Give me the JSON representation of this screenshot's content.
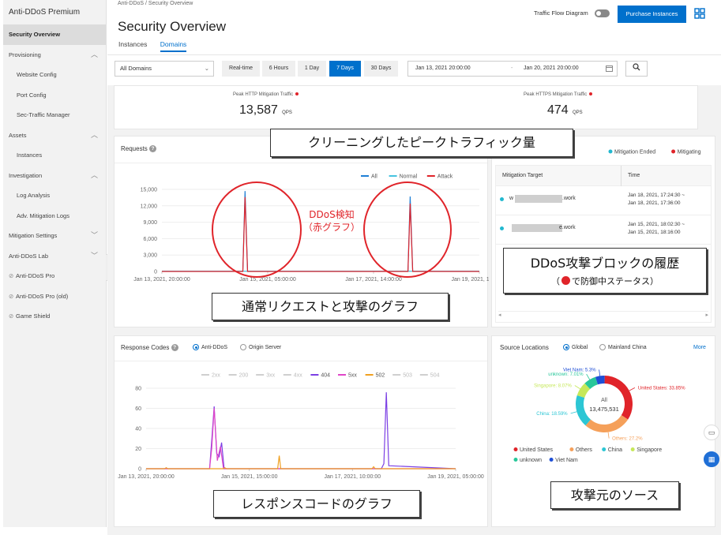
{
  "sidebar": {
    "title": "Anti-DDoS Premium",
    "items": [
      {
        "label": "Security Overview",
        "active": true,
        "type": "top"
      },
      {
        "label": "Provisioning",
        "type": "group",
        "expanded": true
      },
      {
        "label": "Website Config",
        "type": "sub"
      },
      {
        "label": "Port Config",
        "type": "sub"
      },
      {
        "label": "Sec-Traffic Manager",
        "type": "sub"
      },
      {
        "label": "Assets",
        "type": "group",
        "expanded": true
      },
      {
        "label": "Instances",
        "type": "sub"
      },
      {
        "label": "Investigation",
        "type": "group",
        "expanded": true
      },
      {
        "label": "Log Analysis",
        "type": "sub"
      },
      {
        "label": "Adv. Mitigation Logs",
        "type": "sub"
      },
      {
        "label": "Mitigation Settings",
        "type": "group",
        "expanded": false
      },
      {
        "label": "Anti-DDoS Lab",
        "type": "group",
        "expanded": false
      },
      {
        "label": "Anti-DDoS Pro",
        "type": "link"
      },
      {
        "label": "Anti-DDoS Pro (old)",
        "type": "link"
      },
      {
        "label": "Game Shield",
        "type": "link"
      }
    ]
  },
  "header": {
    "breadcrumb": "Anti-DDoS  /  Security Overview",
    "title": "Security Overview",
    "tabs": [
      "Instances",
      "Domains"
    ],
    "active_tab": "Domains",
    "traffic_flow_label": "Traffic Flow Diagram",
    "purchase_label": "Purchase Instances"
  },
  "filter": {
    "domain_select": "All Domains",
    "time_buttons": [
      "Real-time",
      "6 Hours",
      "1 Day",
      "7 Days",
      "30 Days"
    ],
    "active_time": "7 Days",
    "start_date": "Jan 13, 2021 20:00:00",
    "separator": "-",
    "end_date": "Jan 20, 2021 20:00:00"
  },
  "peaks": {
    "http_label": "Peak HTTP Mitigation Traffic",
    "http_value": "13,587",
    "http_unit": "QPS",
    "https_label": "Peak HTTPS Mitigation Traffic",
    "https_value": "474",
    "https_unit": "QPS"
  },
  "requests_card": {
    "title": "Requests",
    "legend": [
      "All",
      "Normal",
      "Attack"
    ],
    "legend_colors": [
      "#1f7fd6",
      "#47c3e0",
      "#e0242a"
    ]
  },
  "mitigation_card": {
    "legend": [
      "Mitigation Ended",
      "Mitigating"
    ],
    "legend_colors": [
      "#22b8cf",
      "#e0242a"
    ],
    "col_target": "Mitigation Target",
    "col_time": "Time",
    "rows": [
      {
        "target_prefix": "w",
        "target_suffix": ".work",
        "time1": "Jan 18, 2021, 17:24:30 ~",
        "time2": "Jan 18, 2021, 17:36:00"
      },
      {
        "target_prefix": "",
        "target_suffix": "e.work",
        "time1": "Jan 15, 2021, 18:02:30 ~",
        "time2": "Jan 15, 2021, 18:16:00"
      }
    ]
  },
  "response_card": {
    "title": "Response Codes",
    "radio1": "Anti-DDoS",
    "radio2": "Origin Server",
    "legend": [
      {
        "name": "2xx",
        "color": "#cfcfcf",
        "active": false
      },
      {
        "name": "200",
        "color": "#cfcfcf",
        "active": false
      },
      {
        "name": "3xx",
        "color": "#cfcfcf",
        "active": false
      },
      {
        "name": "4xx",
        "color": "#cfcfcf",
        "active": false
      },
      {
        "name": "404",
        "color": "#7b3fe4",
        "active": true
      },
      {
        "name": "5xx",
        "color": "#e046c8",
        "active": true
      },
      {
        "name": "502",
        "color": "#f0a020",
        "active": true
      },
      {
        "name": "503",
        "color": "#cfcfcf",
        "active": false
      },
      {
        "name": "504",
        "color": "#cfcfcf",
        "active": false
      }
    ]
  },
  "source_card": {
    "title": "Source Locations",
    "radio1": "Global",
    "radio2": "Mainland China",
    "more": "More",
    "center_label": "All",
    "center_value": "13,475,531",
    "slice_labels": [
      "United States: 33.85%",
      "Others: 27.2%",
      "China: 18.59%",
      "Singapore: 8.07%",
      "unknown: 7.01%",
      "Viet Nam: 5.3%"
    ],
    "legend": [
      {
        "name": "United States",
        "color": "#e0242a"
      },
      {
        "name": "Others",
        "color": "#f5a05a"
      },
      {
        "name": "China",
        "color": "#2cc6d4"
      },
      {
        "name": "Singapore",
        "color": "#c6e85a"
      },
      {
        "name": "unknown",
        "color": "#28c79a"
      },
      {
        "name": "Viet Nam",
        "color": "#1f4fd6"
      }
    ]
  },
  "annotations": {
    "peak_callout": "クリーニングしたピークトラフィック量",
    "ddos_label_1": "DDoS検知",
    "ddos_label_2": "（赤グラフ）",
    "requests_callout": "通常リクエストと攻撃のグラフ",
    "history_callout_1": "DDoS攻撃ブロックの履歴",
    "history_callout_2": "で防御中ステータス）",
    "history_callout_paren": "（",
    "response_callout": "レスポンスコードのグラフ",
    "source_callout": "攻撃元のソース"
  },
  "chart_data": [
    {
      "type": "line",
      "title": "Requests",
      "y_ticks": [
        "15,000",
        "12,000",
        "9,000",
        "6,000",
        "3,000",
        "0"
      ],
      "ylim": [
        0,
        15000
      ],
      "x_tick_labels": [
        "Jan 13, 2021, 20:00:00",
        "Jan 15, 2021, 05:00:00",
        "Jan 17, 2021, 14:00:00",
        "Jan 19, 2021, 11:00:00"
      ],
      "series": [
        {
          "name": "All",
          "color": "#1f7fd6",
          "x": [
            0,
            0.255,
            0.262,
            0.27,
            0.775,
            0.782,
            0.79,
            1
          ],
          "y": [
            40,
            40,
            14700,
            40,
            40,
            13700,
            40,
            40
          ]
        },
        {
          "name": "Normal",
          "color": "#47c3e0",
          "x": [
            0,
            1
          ],
          "y": [
            40,
            40
          ]
        },
        {
          "name": "Attack",
          "color": "#e0242a",
          "x": [
            0,
            0.255,
            0.262,
            0.27,
            0.775,
            0.782,
            0.79,
            1
          ],
          "y": [
            0,
            0,
            13587,
            0,
            0,
            12400,
            0,
            0
          ]
        }
      ]
    },
    {
      "type": "line",
      "title": "Response Codes",
      "y_ticks": [
        "80",
        "60",
        "40",
        "20",
        "0"
      ],
      "ylim": [
        0,
        80
      ],
      "x_tick_labels": [
        "Jan 13, 2021, 20:00:00",
        "Jan 15, 2021, 15:00:00",
        "Jan 17, 2021, 10:00:00",
        "Jan 19, 2021, 05:00:00"
      ],
      "series": [
        {
          "name": "404",
          "color": "#7b3fe4",
          "x": [
            0,
            0.205,
            0.212,
            0.22,
            0.228,
            0.236,
            0.244,
            0.252,
            0.76,
            0.768,
            0.776,
            0.784,
            1
          ],
          "y": [
            0,
            0,
            28,
            62,
            15,
            12,
            26,
            0,
            0,
            5,
            76,
            3,
            0
          ]
        },
        {
          "name": "5xx",
          "color": "#e046c8",
          "x": [
            0,
            0.205,
            0.212,
            0.22,
            0.23,
            0.24,
            0.25,
            1
          ],
          "y": [
            0,
            0,
            20,
            60,
            8,
            22,
            0,
            0
          ]
        },
        {
          "name": "502",
          "color": "#f0a020",
          "x": [
            0,
            0.06,
            0.065,
            0.07,
            0.25,
            0.254,
            0.26,
            0.425,
            0.43,
            0.435,
            0.73,
            0.735,
            0.74,
            1
          ],
          "y": [
            0,
            0,
            1,
            0,
            0,
            1,
            0,
            0,
            13,
            0,
            0,
            2,
            0,
            0
          ]
        }
      ]
    },
    {
      "type": "pie",
      "title": "Source Locations",
      "categories": [
        "United States",
        "Others",
        "China",
        "Singapore",
        "unknown",
        "Viet Nam"
      ],
      "values": [
        33.85,
        27.2,
        18.59,
        8.07,
        7.01,
        5.3
      ],
      "colors": [
        "#e0242a",
        "#f5a05a",
        "#2cc6d4",
        "#c6e85a",
        "#28c79a",
        "#1f4fd6"
      ]
    }
  ]
}
